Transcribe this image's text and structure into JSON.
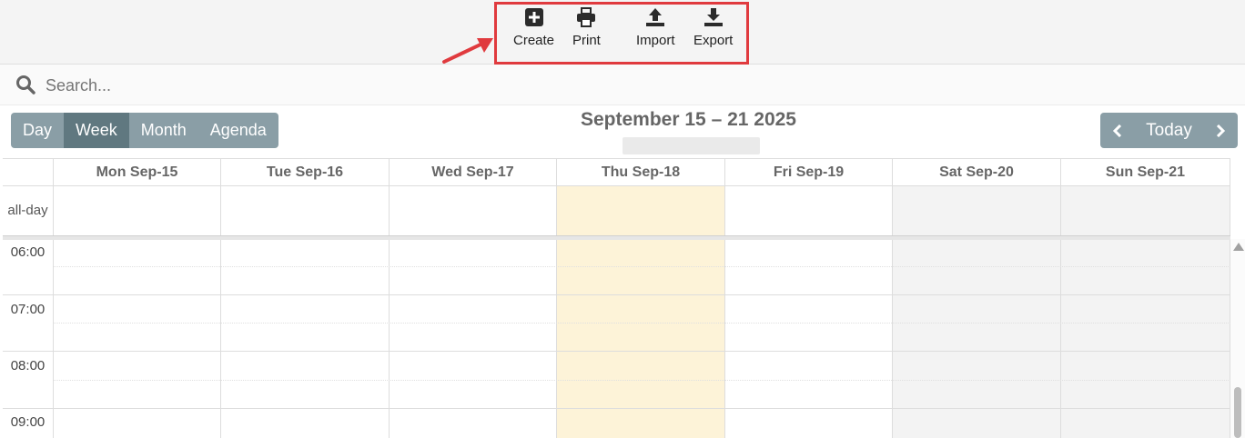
{
  "toolbar": {
    "buttons": [
      {
        "label": "Create",
        "icon": "plus-square-icon"
      },
      {
        "label": "Print",
        "icon": "printer-icon"
      },
      {
        "label": "Import",
        "icon": "upload-icon"
      },
      {
        "label": "Export",
        "icon": "download-icon"
      }
    ],
    "highlight_color": "#e03a3e"
  },
  "search": {
    "placeholder": "Search..."
  },
  "views": {
    "items": [
      "Day",
      "Week",
      "Month",
      "Agenda"
    ],
    "active": "Week"
  },
  "calendar": {
    "title": "September 15 – 21 2025",
    "nav_today": "Today",
    "days": [
      "Mon Sep-15",
      "Tue Sep-16",
      "Wed Sep-17",
      "Thu Sep-18",
      "Fri Sep-19",
      "Sat Sep-20",
      "Sun Sep-21"
    ],
    "today": "Thu Sep-18",
    "allday_label": "all-day",
    "times": [
      "06:00",
      "07:00",
      "08:00",
      "09:00"
    ]
  },
  "colors": {
    "today_bg": "#fdf3d8",
    "weekend_bg": "#f3f3f3",
    "view_button": "#8a9ea6",
    "view_button_active": "#607880"
  }
}
